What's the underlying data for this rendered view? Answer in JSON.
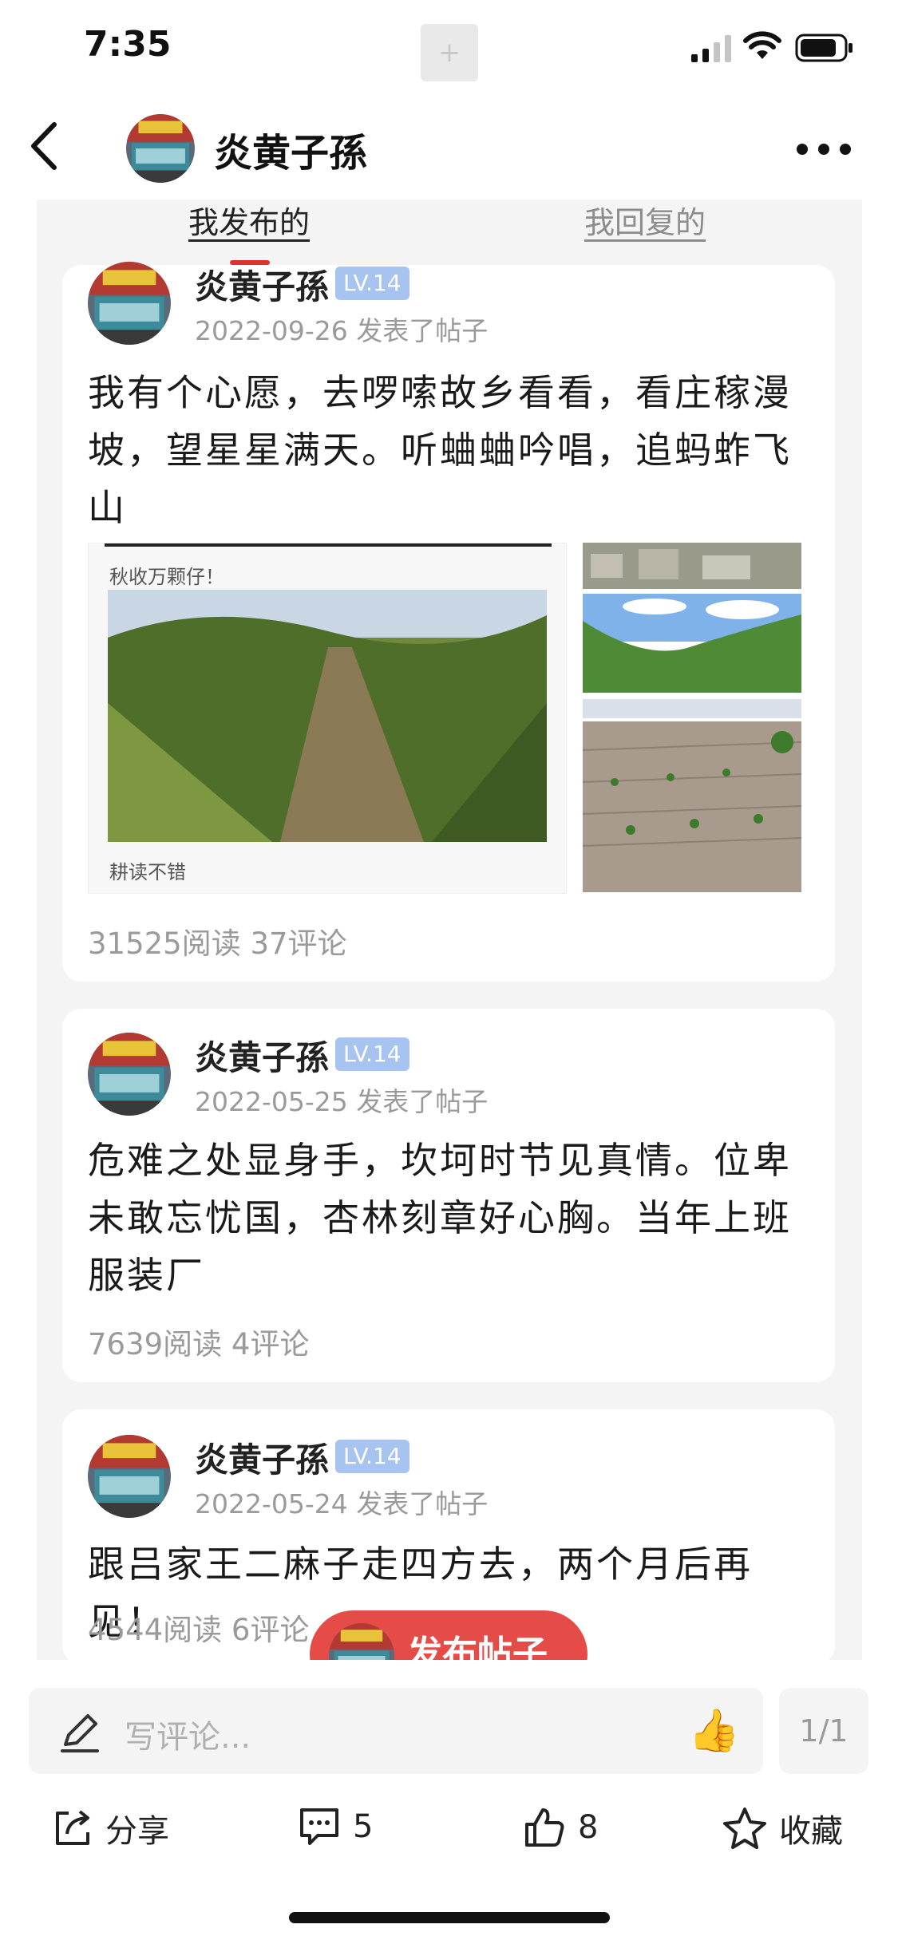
{
  "status_bar": {
    "time": "7:35"
  },
  "header": {
    "title": "炎黄子孫"
  },
  "tabs": [
    {
      "label": "我发布的",
      "active": true
    },
    {
      "label": "我回复的",
      "active": false
    }
  ],
  "posts": [
    {
      "username": "炎黄子孫",
      "level": "LV.14",
      "timestamp": "2022-09-26 发表了帖子",
      "text": "我有个心愿，去啰嗦故乡看看，看庄稼漫坡，望星星满天。听蛐蛐吟唱，追蚂蚱飞山",
      "stats": "31525阅读  37评论",
      "image_caption_top": "秋收万颗仔！",
      "image_caption_bottom": "耕读不错"
    },
    {
      "username": "炎黄子孫",
      "level": "LV.14",
      "timestamp": "2022-05-25 发表了帖子",
      "text": "危难之处显身手，坎坷时节见真情。位卑未敢忘忧国，杏林刻章好心胸。当年上班服装厂",
      "stats": "7639阅读  4评论"
    },
    {
      "username": "炎黄子孫",
      "level": "LV.14",
      "timestamp": "2022-05-24 发表了帖子",
      "text": "跟吕家王二麻子走四方去，两个月后再见！",
      "stats": "4544阅读  6评论"
    }
  ],
  "floating_button": {
    "label": "发布帖子"
  },
  "comment_bar": {
    "placeholder": "写评论...",
    "thumb": "👍",
    "page": "1/1"
  },
  "actions": {
    "share": "分享",
    "comment_count": "5",
    "like_count": "8",
    "favorite": "收藏"
  },
  "colors": {
    "accent": "#e54b47",
    "level_badge": "#a7c3f0",
    "tab_indicator": "#e0312f"
  },
  "icons": [
    "back-icon",
    "more-icon",
    "pen-icon",
    "share-icon",
    "comment-icon",
    "like-icon",
    "star-icon"
  ]
}
